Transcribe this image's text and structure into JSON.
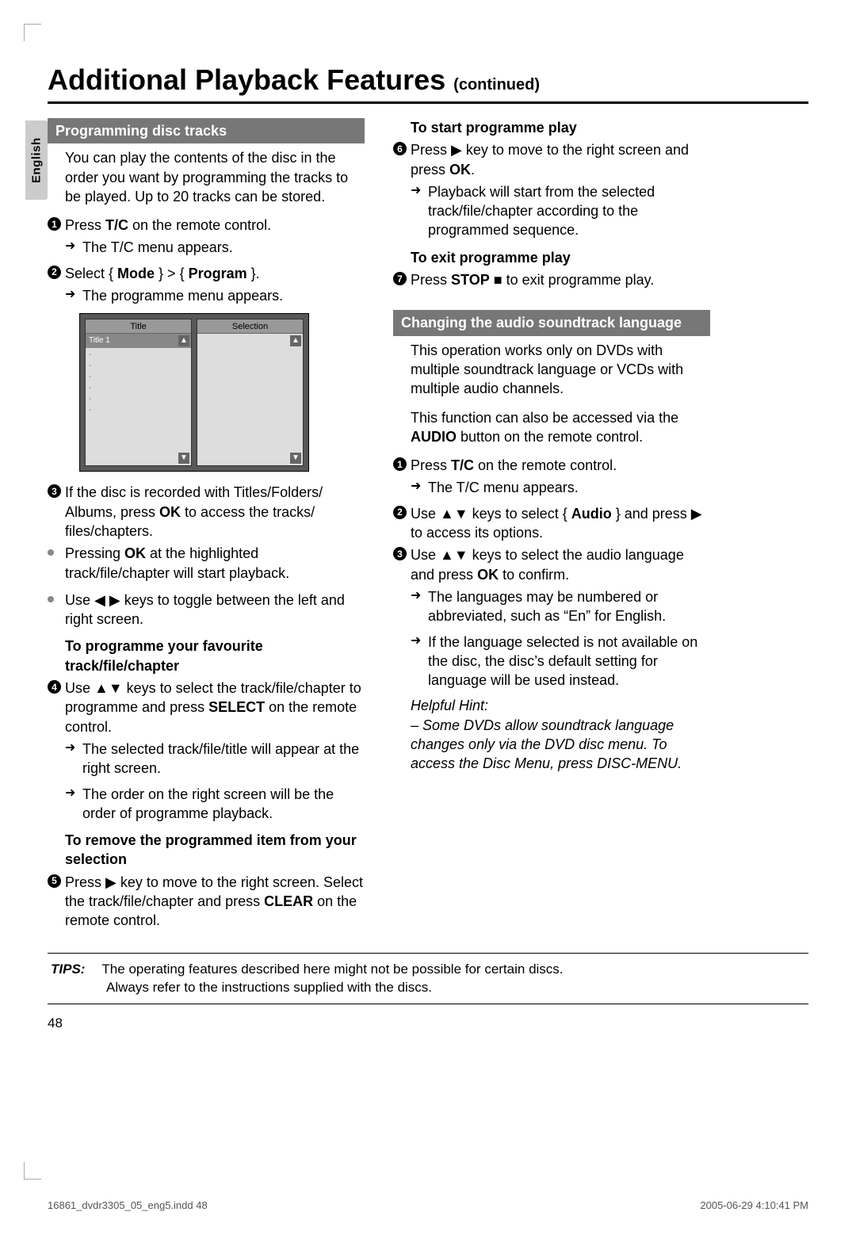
{
  "lang_tab": "English",
  "title_main": "Additional Playback Features ",
  "title_cont": "(continued)",
  "col_left": {
    "sec1_head": "Programming disc tracks",
    "sec1_intro": "You can play the contents of the disc in the order you want by programming the tracks to be played. Up to 20 tracks can be stored.",
    "step1_a": "Press ",
    "step1_b": "T/C",
    "step1_c": " on the remote control.",
    "step1_res": "The T/C menu appears.",
    "step2_a": "Select { ",
    "step2_b": "Mode",
    "step2_c": " } > { ",
    "step2_d": "Program",
    "step2_e": " }.",
    "step2_res": "The programme menu appears.",
    "shot_left_head": "Title",
    "shot_left_row1": "Title 1",
    "shot_right_head": "Selection",
    "step3_a": "If the disc is recorded with Titles/Folders/ Albums, press ",
    "step3_b": "OK",
    "step3_c": " to access the tracks/ files/chapters.",
    "bul1_a": "Pressing ",
    "bul1_b": "OK",
    "bul1_c": " at the highlighted track/file/chapter will start playback.",
    "bul2": "Use ◀ ▶ keys to toggle between the left and right screen.",
    "sub_prog": "To programme your favourite track/file/chapter",
    "step4_a": "Use ▲▼ keys to select the track/file/chapter to programme and press ",
    "step4_b": "SELECT",
    "step4_c": " on the remote control.",
    "step4_res1": "The selected track/file/title will appear at the right screen.",
    "step4_res2": "The order on the right screen will be the order of programme playback.",
    "sub_remove": "To remove the programmed item from your selection",
    "step5_a": "Press ▶ key to move to the right screen. Select the track/file/chapter and press ",
    "step5_b": "CLEAR",
    "step5_c": " on the remote control."
  },
  "col_right": {
    "sub_start": "To start programme play",
    "step6_a": "Press ▶ key to move to the right screen and press ",
    "step6_b": "OK",
    "step6_c": ".",
    "step6_res": "Playback will start from the selected track/file/chapter according to the programmed sequence.",
    "sub_exit": "To exit programme play",
    "step7_a": "Press ",
    "step7_b": "STOP",
    "step7_c": " ■ to exit programme play.",
    "sec2_head": "Changing the audio soundtrack language",
    "sec2_p1": "This operation works only on DVDs with multiple soundtrack language or VCDs with multiple audio channels.",
    "sec2_p2_a": "This function can also be accessed via the ",
    "sec2_p2_b": "AUDIO",
    "sec2_p2_c": " button on the remote control.",
    "r_step1_a": "Press ",
    "r_step1_b": "T/C",
    "r_step1_c": " on the remote control.",
    "r_step1_res": "The T/C menu appears.",
    "r_step2_a": "Use ▲▼ keys to select { ",
    "r_step2_b": "Audio",
    "r_step2_c": " } and press ▶ to access its options.",
    "r_step3_a": "Use ▲▼ keys to select the audio language and press ",
    "r_step3_b": "OK",
    "r_step3_c": " to confirm.",
    "r_step3_res1": "The languages may be numbered or abbreviated, such as “En” for English.",
    "r_step3_res2": "If the language selected is not available on the disc, the disc’s default setting for language will be used instead.",
    "hint_head": "Helpful Hint:",
    "hint_body": "– Some DVDs allow soundtrack language changes only via the DVD disc menu. To access the Disc Menu, press DISC-MENU."
  },
  "tips": {
    "label": "TIPS:",
    "line1": "The operating features described here might not be possible for certain discs.",
    "line2": "Always refer to the instructions supplied with the discs."
  },
  "page_number": "48",
  "footer_left": "16861_dvdr3305_05_eng5.indd   48",
  "footer_right": "2005-06-29   4:10:41 PM"
}
